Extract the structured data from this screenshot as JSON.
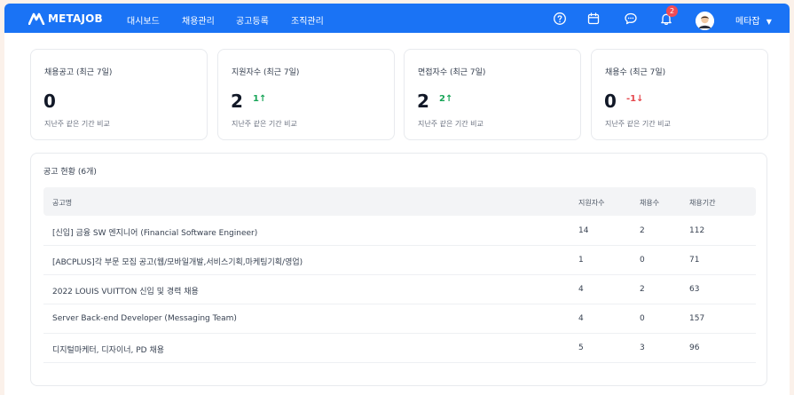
{
  "header": {
    "logo_text": "METAJOB",
    "nav": [
      "대시보드",
      "채용관리",
      "공고등록",
      "조직관리"
    ],
    "notification_count": "2",
    "user_name": "메타잡",
    "user_caret": "▼"
  },
  "stats": [
    {
      "title": "채용공고 (최근 7일)",
      "value": "0",
      "delta": "",
      "sub": "지난주 같은 기간 비교"
    },
    {
      "title": "지원자수 (최근 7일)",
      "value": "2",
      "delta": "1↑",
      "sub": "지난주 같은 기간 비교"
    },
    {
      "title": "면접자수 (최근 7일)",
      "value": "2",
      "delta": "2↑",
      "sub": "지난주 같은 기간 비교"
    },
    {
      "title": "채용수 (최근 7일)",
      "value": "0",
      "delta": "-1↓",
      "sub": "지난주 같은 기간 비교"
    }
  ],
  "table": {
    "title": "공고 현황 (6개)",
    "columns": [
      "공고명",
      "지원자수",
      "채용수",
      "채용기간"
    ],
    "rows": [
      {
        "name": "[신입] 금융 SW 엔지니어 (Financial Software Engineer)",
        "applicants": "14",
        "hires": "2",
        "period": "112"
      },
      {
        "name": "[ABCPLUS]각 부문 모집 공고(웹/모바일개발,서비스기획,마케팅기획/영업)",
        "applicants": "1",
        "hires": "0",
        "period": "71"
      },
      {
        "name": "2022 LOUIS VUITTON 신입 및 경력 채용",
        "applicants": "4",
        "hires": "2",
        "period": "63"
      },
      {
        "name": "Server Back-end Developer (Messaging Team)",
        "applicants": "4",
        "hires": "0",
        "period": "157"
      },
      {
        "name": "디지털마케터, 디자이너, PD 채용",
        "applicants": "5",
        "hires": "3",
        "period": "96"
      }
    ]
  },
  "icons": [
    "help-icon",
    "calendar-icon",
    "chat-icon",
    "bell-icon"
  ],
  "colors": {
    "brand": "#1a73f5",
    "up": "#18a558",
    "down": "#e5484d",
    "badge": "#f04b55"
  }
}
